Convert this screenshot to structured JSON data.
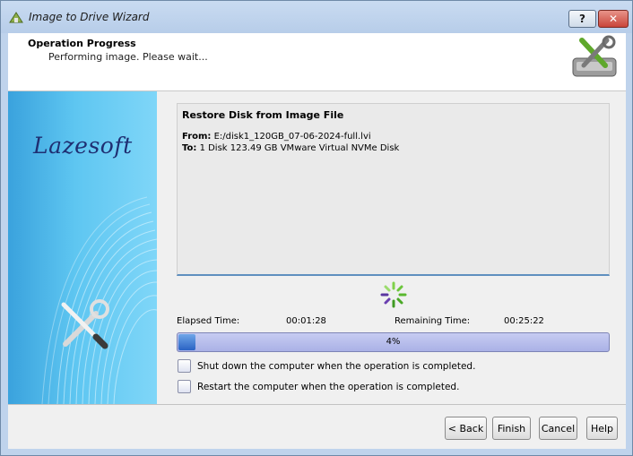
{
  "window": {
    "title": "Image to Drive Wizard",
    "help_label": "?",
    "close_label": "✕"
  },
  "header": {
    "title": "Operation Progress",
    "subtitle": "Performing image. Please wait..."
  },
  "side_panel": {
    "brand": "Lazesoft"
  },
  "task": {
    "title": "Restore Disk from Image File",
    "from_label": "From:",
    "from_value": "E:/disk1_120GB_07-06-2024-full.lvi",
    "to_label": "To:",
    "to_value": "1 Disk 123.49 GB VMware Virtual NVMe Disk"
  },
  "timing": {
    "elapsed_label": "Elapsed Time:",
    "elapsed_value": "00:01:28",
    "remaining_label": "Remaining Time:",
    "remaining_value": "00:25:22"
  },
  "progress": {
    "percent": 4,
    "label": "4%"
  },
  "options": {
    "shutdown_label": "Shut down the computer when the operation is completed.",
    "restart_label": "Restart the computer when the operation is completed."
  },
  "buttons": {
    "back": "< Back",
    "finish": "Finish",
    "cancel": "Cancel",
    "help": "Help"
  },
  "icons": {
    "title": "wizard-icon",
    "header": "tools-icon",
    "spinner": "loading-spinner-icon"
  },
  "colors": {
    "accent": "#2b63c4",
    "progress_track": "#aab1e6",
    "brand_text": "#1f2f72"
  }
}
